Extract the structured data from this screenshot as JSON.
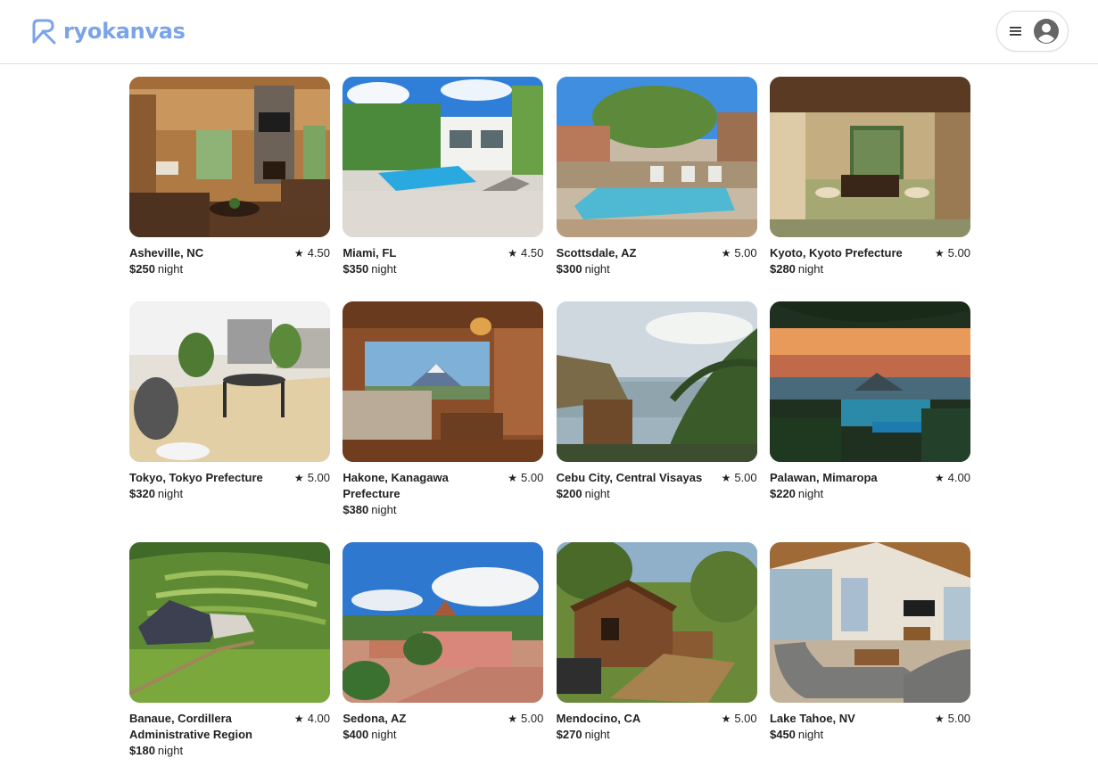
{
  "app": {
    "logo_text": "ryokanvas",
    "brand_color": "#7ba4e8"
  },
  "header": {
    "menu_icon": "hamburger-icon",
    "avatar_icon": "user-avatar-icon"
  },
  "listings": [
    {
      "location": "Asheville, NC",
      "rating": "4.50",
      "price": "$250",
      "unit": "night",
      "scene": "cabin-living-room"
    },
    {
      "location": "Miami, FL",
      "rating": "4.50",
      "price": "$350",
      "unit": "night",
      "scene": "modern-villa-pool"
    },
    {
      "location": "Scottsdale, AZ",
      "rating": "5.00",
      "price": "$300",
      "unit": "night",
      "scene": "desert-pool"
    },
    {
      "location": "Kyoto, Kyoto Prefecture",
      "rating": "5.00",
      "price": "$280",
      "unit": "night",
      "scene": "tatami-room"
    },
    {
      "location": "Tokyo, Tokyo Prefecture",
      "rating": "5.00",
      "price": "$320",
      "unit": "night",
      "scene": "rooftop-terrace"
    },
    {
      "location": "Hakone, Kanagawa Prefecture",
      "rating": "5.00",
      "price": "$380",
      "unit": "night",
      "scene": "fuji-view-lounge"
    },
    {
      "location": "Cebu City, Central Visayas",
      "rating": "5.00",
      "price": "$200",
      "unit": "night",
      "scene": "tropical-hut"
    },
    {
      "location": "Palawan, Mimaropa",
      "rating": "4.00",
      "price": "$220",
      "unit": "night",
      "scene": "sunset-pool"
    },
    {
      "location": "Banaue, Cordillera Administrative Region",
      "rating": "4.00",
      "price": "$180",
      "unit": "night",
      "scene": "rice-terraces"
    },
    {
      "location": "Sedona, AZ",
      "rating": "5.00",
      "price": "$400",
      "unit": "night",
      "scene": "red-rock-house"
    },
    {
      "location": "Mendocino, CA",
      "rating": "5.00",
      "price": "$270",
      "unit": "night",
      "scene": "forest-cabin"
    },
    {
      "location": "Lake Tahoe, NV",
      "rating": "5.00",
      "price": "$450",
      "unit": "night",
      "scene": "lake-view-living-room"
    }
  ]
}
